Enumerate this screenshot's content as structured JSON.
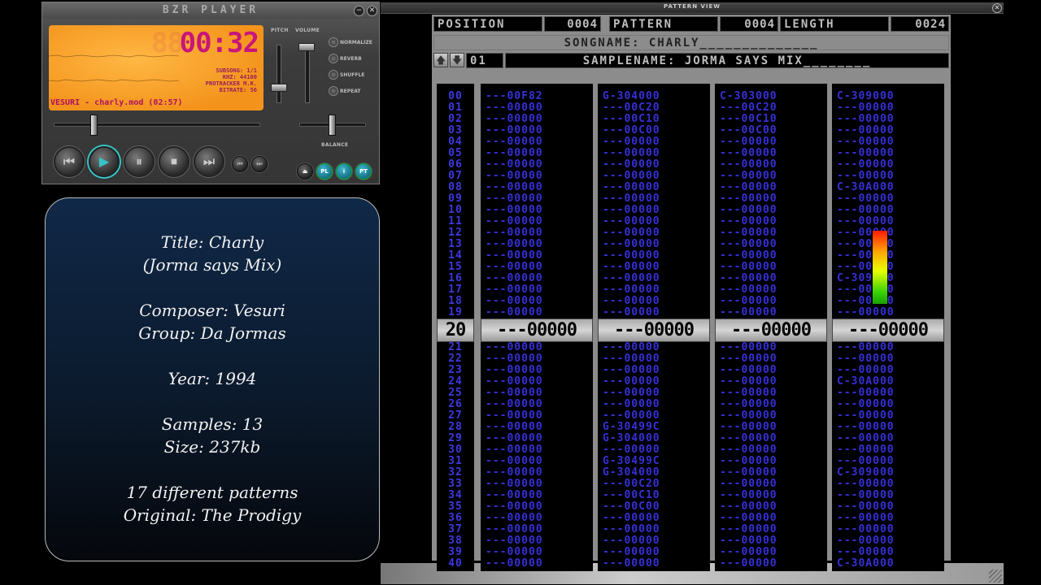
{
  "player": {
    "title": "BZR PLAYER",
    "minimize_label": "−",
    "close_label": "✕",
    "time": "00:32",
    "time_ghost": "88",
    "subsong": "SUBSONG: 1/1",
    "khz": "KHZ: 44100",
    "format": "PROTRACKER M.K.",
    "bitrate": "BITRATE: 56",
    "now_playing": "VESURI - charly.mod (02:57)",
    "labels": {
      "pitch": "PITCH",
      "volume": "VOLUME",
      "balance": "BALANCE"
    },
    "options": [
      "NORMALIZE",
      "REVERB",
      "SHUFFLE",
      "REPEAT"
    ],
    "transport": {
      "prev": "⏮",
      "play": "▶",
      "pause": "⏸",
      "stop": "⏹",
      "next": "⏭",
      "small_prev": "⏮",
      "small_next": "⏭"
    },
    "extra_buttons": {
      "eject": "⏏",
      "pl": "PL",
      "info": "i",
      "pt": "PT"
    },
    "position_fraction": 0.18,
    "balance_fraction": 0.5
  },
  "info": {
    "lines": [
      "Title: Charly",
      "(Jorma says Mix)",
      "",
      "Composer: Vesuri",
      "Group: Da Jormas",
      "",
      "Year: 1994",
      "",
      "Samples: 13",
      "Size: 237kb",
      "",
      "17 different patterns",
      "Original: The Prodigy"
    ]
  },
  "pattern_view": {
    "window_title": "PATTERN VIEW",
    "close_label": "✕",
    "position_label": "POSITION",
    "position_value": "0004",
    "pattern_label": "PATTERN",
    "pattern_value": "0004",
    "length_label": "LENGTH",
    "length_value": "0024",
    "songname": "SONGNAME: CHARLY______________",
    "sample_number": "01",
    "samplename": "SAMPLENAME: JORMA SAYS MIX________",
    "arrow_up": "🡅",
    "arrow_down": "🡇",
    "current_row": {
      "num": "20",
      "channels": [
        "---00000",
        "---00000",
        "---00000",
        "---00000"
      ]
    },
    "rows_before": [
      {
        "num": "00",
        "c": [
          "---00F82",
          "G-304000",
          "C-303000",
          "C-309000"
        ]
      },
      {
        "num": "01",
        "c": [
          "---00000",
          "---00C20",
          "---00C20",
          "---00000"
        ]
      },
      {
        "num": "02",
        "c": [
          "---00000",
          "---00C10",
          "---00C10",
          "---00000"
        ]
      },
      {
        "num": "03",
        "c": [
          "---00000",
          "---00C00",
          "---00C00",
          "---00000"
        ]
      },
      {
        "num": "04",
        "c": [
          "---00000",
          "---00000",
          "---00000",
          "---00000"
        ]
      },
      {
        "num": "05",
        "c": [
          "---00000",
          "---00000",
          "---00000",
          "---00000"
        ]
      },
      {
        "num": "06",
        "c": [
          "---00000",
          "---00000",
          "---00000",
          "---00000"
        ]
      },
      {
        "num": "07",
        "c": [
          "---00000",
          "---00000",
          "---00000",
          "---00000"
        ]
      },
      {
        "num": "08",
        "c": [
          "---00000",
          "---00000",
          "---00000",
          "C-30A000"
        ]
      },
      {
        "num": "09",
        "c": [
          "---00000",
          "---00000",
          "---00000",
          "---00000"
        ]
      },
      {
        "num": "10",
        "c": [
          "---00000",
          "---00000",
          "---00000",
          "---00000"
        ]
      },
      {
        "num": "11",
        "c": [
          "---00000",
          "---00000",
          "---00000",
          "---00000"
        ]
      },
      {
        "num": "12",
        "c": [
          "---00000",
          "---00000",
          "---00000",
          "---00000"
        ]
      },
      {
        "num": "13",
        "c": [
          "---00000",
          "---00000",
          "---00000",
          "---00000"
        ]
      },
      {
        "num": "14",
        "c": [
          "---00000",
          "---00000",
          "---00000",
          "---00000"
        ]
      },
      {
        "num": "15",
        "c": [
          "---00000",
          "---00000",
          "---00000",
          "---00000"
        ]
      },
      {
        "num": "16",
        "c": [
          "---00000",
          "---00000",
          "---00000",
          "C-309000"
        ]
      },
      {
        "num": "17",
        "c": [
          "---00000",
          "---00000",
          "---00000",
          "---00000"
        ]
      },
      {
        "num": "18",
        "c": [
          "---00000",
          "---00000",
          "---00000",
          "---00000"
        ]
      },
      {
        "num": "19",
        "c": [
          "---00000",
          "---00000",
          "---00000",
          "---00000"
        ]
      }
    ],
    "rows_after": [
      {
        "num": "21",
        "c": [
          "---00000",
          "---00000",
          "---00000",
          "---00000"
        ]
      },
      {
        "num": "22",
        "c": [
          "---00000",
          "---00000",
          "---00000",
          "---00000"
        ]
      },
      {
        "num": "23",
        "c": [
          "---00000",
          "---00000",
          "---00000",
          "---00000"
        ]
      },
      {
        "num": "24",
        "c": [
          "---00000",
          "---00000",
          "---00000",
          "C-30A000"
        ]
      },
      {
        "num": "25",
        "c": [
          "---00000",
          "---00000",
          "---00000",
          "---00000"
        ]
      },
      {
        "num": "26",
        "c": [
          "---00000",
          "---00000",
          "---00000",
          "---00000"
        ]
      },
      {
        "num": "27",
        "c": [
          "---00000",
          "---00000",
          "---00000",
          "---00000"
        ]
      },
      {
        "num": "28",
        "c": [
          "---00000",
          "G-30499C",
          "---00000",
          "---00000"
        ]
      },
      {
        "num": "29",
        "c": [
          "---00000",
          "G-304000",
          "---00000",
          "---00000"
        ]
      },
      {
        "num": "30",
        "c": [
          "---00000",
          "---00000",
          "---00000",
          "---00000"
        ]
      },
      {
        "num": "31",
        "c": [
          "---00000",
          "G-30499C",
          "---00000",
          "---00000"
        ]
      },
      {
        "num": "32",
        "c": [
          "---00000",
          "G-304000",
          "---00000",
          "C-309000"
        ]
      },
      {
        "num": "33",
        "c": [
          "---00000",
          "---00C20",
          "---00000",
          "---00000"
        ]
      },
      {
        "num": "34",
        "c": [
          "---00000",
          "---00C10",
          "---00000",
          "---00000"
        ]
      },
      {
        "num": "35",
        "c": [
          "---00000",
          "---00C00",
          "---00000",
          "---00000"
        ]
      },
      {
        "num": "36",
        "c": [
          "---00000",
          "---00000",
          "---00000",
          "---00000"
        ]
      },
      {
        "num": "37",
        "c": [
          "---00000",
          "---00000",
          "---00000",
          "---00000"
        ]
      },
      {
        "num": "38",
        "c": [
          "---00000",
          "---00000",
          "---00000",
          "---00000"
        ]
      },
      {
        "num": "39",
        "c": [
          "---00000",
          "---00000",
          "---00000",
          "---00000"
        ]
      },
      {
        "num": "40",
        "c": [
          "---00000",
          "---00000",
          "---00000",
          "C-30A000"
        ]
      }
    ],
    "vu_level_fraction": 0.9
  },
  "colors": {
    "lcd": "#f3931b",
    "time": "#c8167a",
    "pattern_text": "#3630d8",
    "accent": "#35c5c8"
  },
  "icons": {
    "eject": "eject-icon",
    "info": "info-icon",
    "close": "close-icon",
    "prev": "previous-icon",
    "next": "next-icon"
  }
}
